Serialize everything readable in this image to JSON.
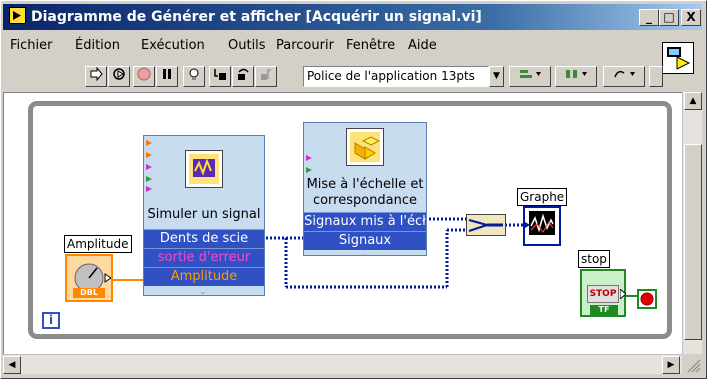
{
  "window": {
    "title": "Diagramme de Générer et afficher [Acquérir un signal.vi]",
    "controls": [
      "_",
      "□",
      "X"
    ]
  },
  "menu": [
    "Fichier",
    "Édition",
    "Exécution",
    "Outils",
    "Parcourir",
    "Fenêtre",
    "Aide"
  ],
  "toolbar": {
    "font_selector": "Police de l'application 13pts"
  },
  "diagram": {
    "simulate": {
      "title": "Simuler un signal",
      "rows": [
        "Dents de scie",
        "sortie d'erreur",
        "Amplitude"
      ]
    },
    "scale": {
      "title": "Mise à l'échelle et correspondance",
      "rows": [
        "Signaux mis à l'écł",
        "Signaux"
      ]
    },
    "amplitude_label": "Amplitude",
    "amplitude_terminal_text": "DBL",
    "graph_label": "Graphe",
    "stop_label": "stop",
    "stop_button_text": "STOP",
    "stop_tf_text": "TF",
    "loop_info_text": "i"
  },
  "colors": {
    "title_gradient_start": "#0a246a",
    "express_row_bg": "#2f51c4",
    "express_row_orange": "#ff9900",
    "express_row_pink": "#ff44cc",
    "express_bg": "#c8dcf0",
    "wire_blue": "#001a99",
    "amplitude_orange": "#ff8800",
    "stop_green": "#1f8a1f"
  }
}
